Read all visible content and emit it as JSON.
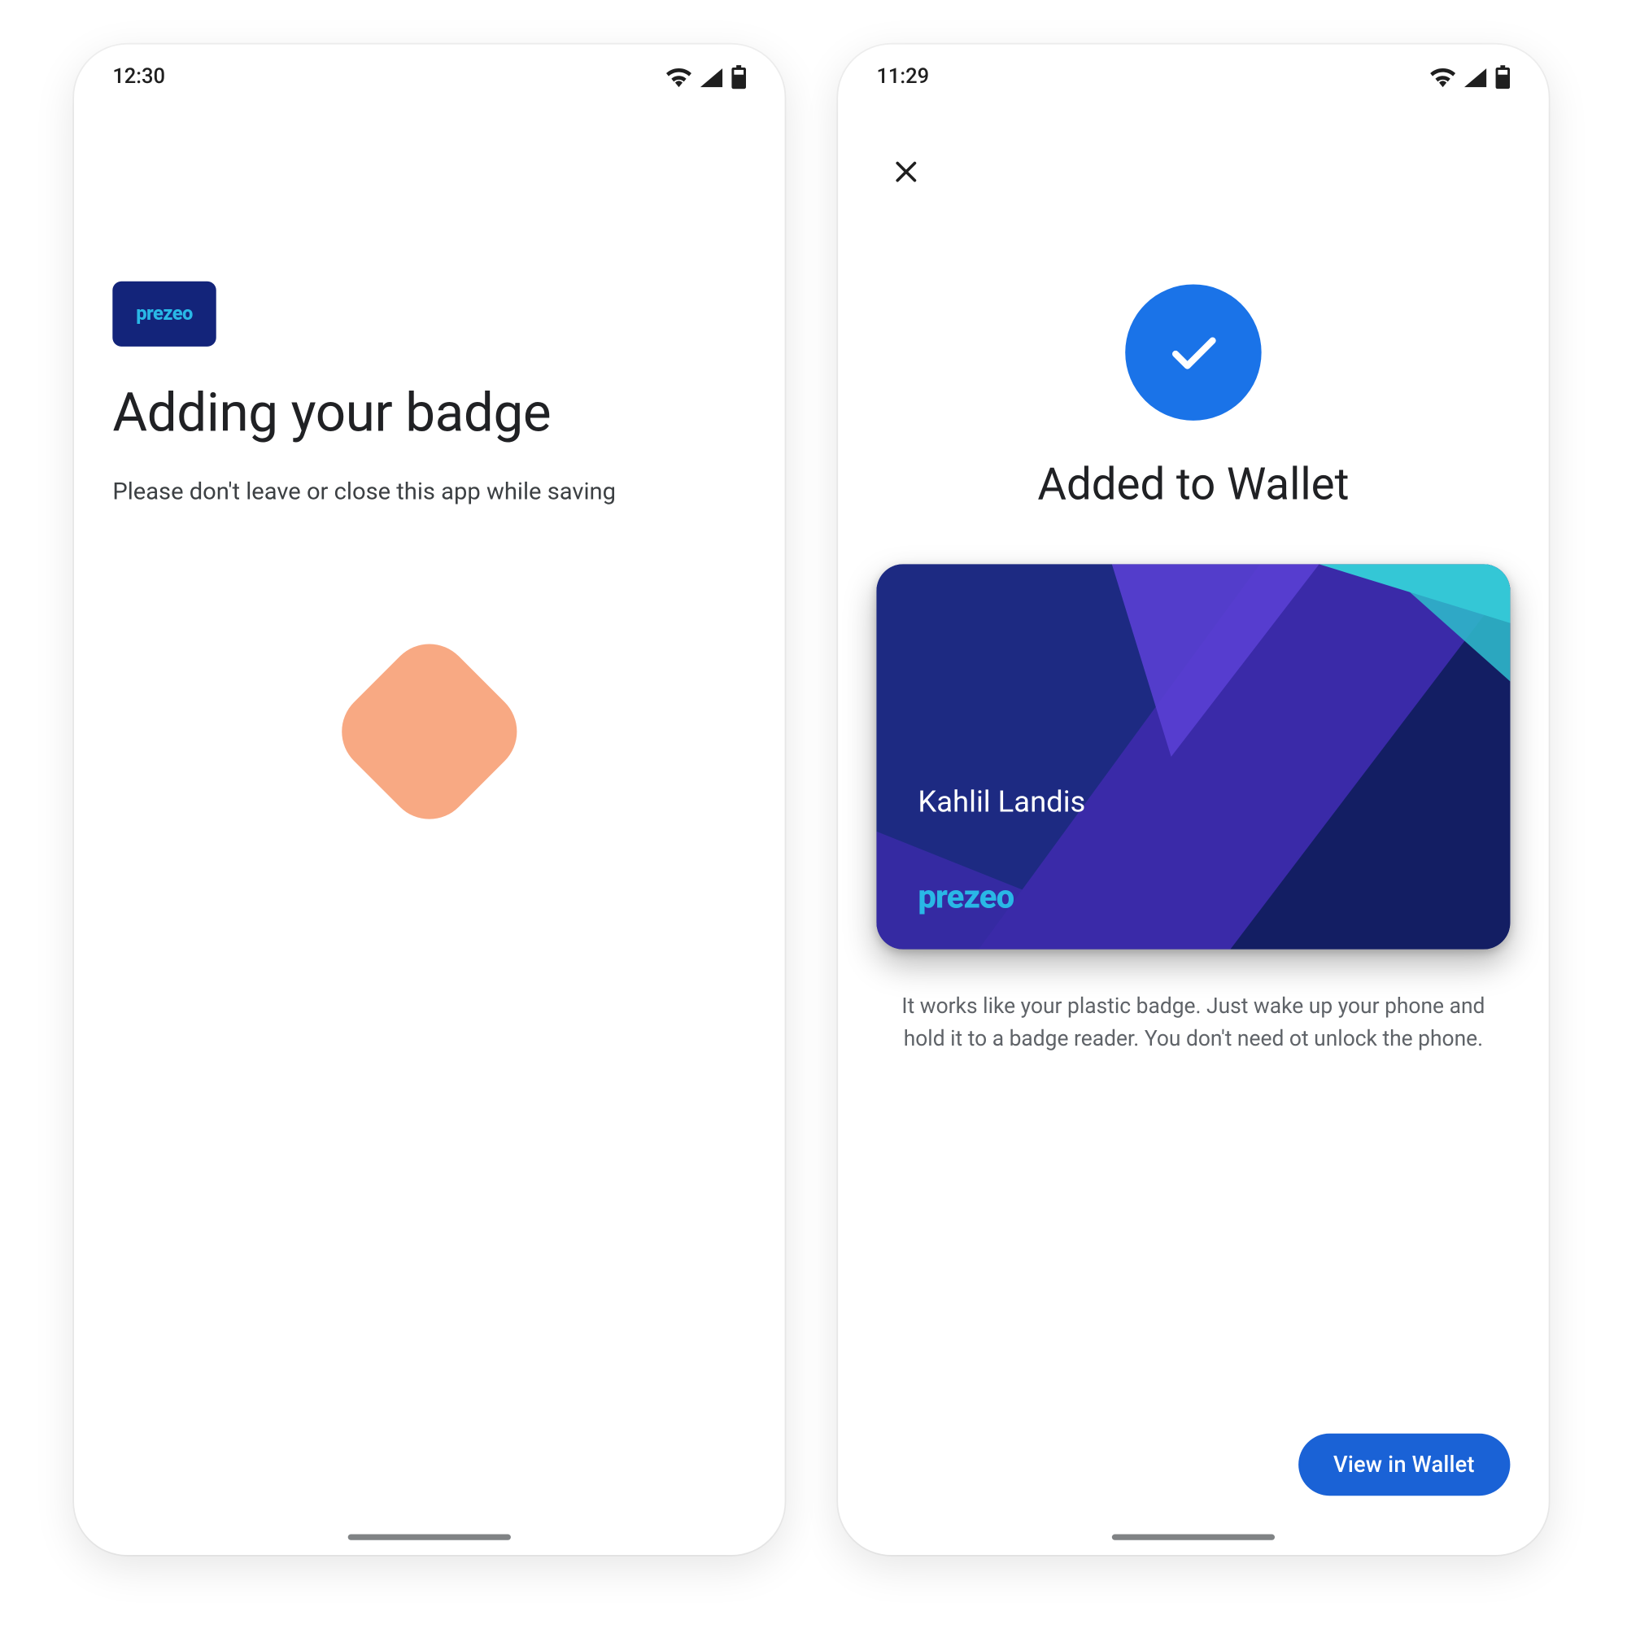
{
  "colors": {
    "accent": "#1a73e8",
    "cta": "#1a62d6",
    "brand_chip_bg": "#13247a",
    "brand_text": "#29b8e6",
    "loader": "#f8a983",
    "text_primary": "#202124",
    "text_secondary": "#5f6368"
  },
  "screen1": {
    "status_time": "12:30",
    "brand_label": "prezeo",
    "title": "Adding your badge",
    "subtitle": "Please don't leave or close this app while saving"
  },
  "screen2": {
    "status_time": "11:29",
    "close_icon_name": "close-icon",
    "checkmark_icon_name": "check-icon",
    "title": "Added to Wallet",
    "card": {
      "holder_name": "Kahlil Landis",
      "brand_label": "prezeo"
    },
    "description": "It works like your plastic badge. Just wake up your phone and hold it to a badge reader. You don't need ot unlock the phone.",
    "cta_label": "View in Wallet"
  }
}
